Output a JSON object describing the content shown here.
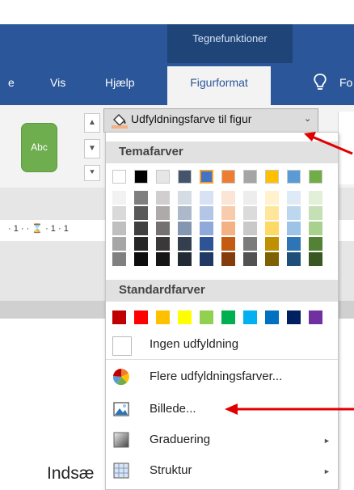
{
  "ribbon": {
    "contextual_group": "Tegnefunktioner",
    "tabs": [
      {
        "label": "e"
      },
      {
        "label": "Vis"
      },
      {
        "label": "Hjælp"
      },
      {
        "label": "Figurformat",
        "active": true
      },
      {
        "label": "Fo"
      }
    ],
    "style_preview": "Abc",
    "spin_up": "▲",
    "spin_down": "▼",
    "spin_more": "⯆"
  },
  "ruler": {
    "text": "· 1 · · ⌛ · 1 · 1"
  },
  "document": {
    "insert_text": "Indsæ"
  },
  "fill_button": {
    "label": "Udfyldningsfarve til figur",
    "chevron": "⌄",
    "icon": "paint-bucket-icon",
    "fill_color": "#f4b183"
  },
  "menu": {
    "theme_header": "Temafarver",
    "standard_header": "Standardfarver",
    "theme_top_row": [
      "#ffffff",
      "#000000",
      "#e7e6e6",
      "#44546a",
      "#4472c4",
      "#ed7d31",
      "#a5a5a5",
      "#ffc000",
      "#5b9bd5",
      "#70ad47"
    ],
    "theme_shades": [
      [
        "#f2f2f2",
        "#d9d9d9",
        "#bfbfbf",
        "#a6a6a6",
        "#808080"
      ],
      [
        "#7f7f7f",
        "#595959",
        "#404040",
        "#262626",
        "#0d0d0d"
      ],
      [
        "#d0cece",
        "#aeaaaa",
        "#757171",
        "#3a3838",
        "#171616"
      ],
      [
        "#d6dce4",
        "#adb9ca",
        "#8497b0",
        "#333f4f",
        "#222a35"
      ],
      [
        "#d9e2f3",
        "#b4c6e7",
        "#8eaadb",
        "#2f5496",
        "#1f3864"
      ],
      [
        "#fbe5d6",
        "#f8cbad",
        "#f4b183",
        "#c55a11",
        "#843c0c"
      ],
      [
        "#ededed",
        "#dbdbdb",
        "#c9c9c9",
        "#7b7b7b",
        "#525252"
      ],
      [
        "#fff2cc",
        "#ffe699",
        "#ffd966",
        "#bf9000",
        "#7f6000"
      ],
      [
        "#deebf7",
        "#bdd7ee",
        "#9dc3e6",
        "#2e75b6",
        "#1f4e79"
      ],
      [
        "#e2f0d9",
        "#c5e0b4",
        "#a9d18e",
        "#548235",
        "#385723"
      ]
    ],
    "standard_colors": [
      "#c00000",
      "#ff0000",
      "#ffc000",
      "#ffff00",
      "#92d050",
      "#00b050",
      "#00b0f0",
      "#0070c0",
      "#002060",
      "#7030a0"
    ],
    "no_fill": "Ingen udfyldning",
    "more_colors": "Flere udfyldningsfarver...",
    "picture": "Billede...",
    "gradient": "Graduering",
    "texture": "Struktur",
    "submenu_arrow": "►",
    "annotation_color": "#e00000"
  }
}
